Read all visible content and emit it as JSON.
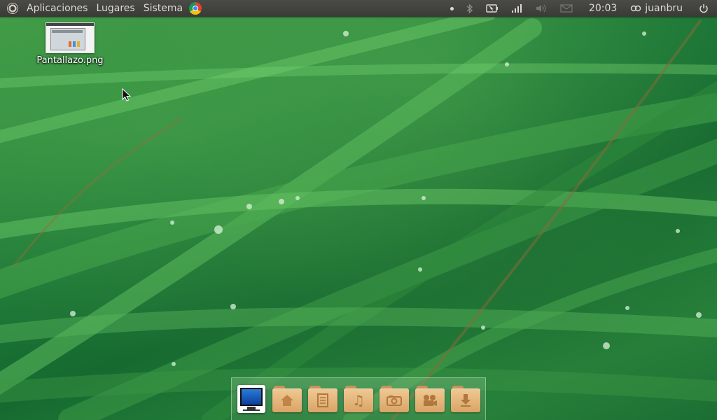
{
  "top_panel": {
    "menus": [
      {
        "label": "Aplicaciones"
      },
      {
        "label": "Lugares"
      },
      {
        "label": "Sistema"
      }
    ],
    "clock": "20:03",
    "user": "juanbru"
  },
  "desktop": {
    "files": [
      {
        "label": "Pantallazo.png"
      }
    ]
  },
  "dock": {
    "items": [
      {
        "icon": "computer-icon"
      },
      {
        "icon": "home-folder-icon"
      },
      {
        "icon": "documents-folder-icon"
      },
      {
        "icon": "music-folder-icon"
      },
      {
        "icon": "pictures-folder-icon"
      },
      {
        "icon": "videos-folder-icon"
      },
      {
        "icon": "downloads-folder-icon"
      }
    ]
  },
  "colors": {
    "panel": "#3c3b37",
    "panel_text": "#dfdbd2",
    "folder": "#e8b87a"
  }
}
